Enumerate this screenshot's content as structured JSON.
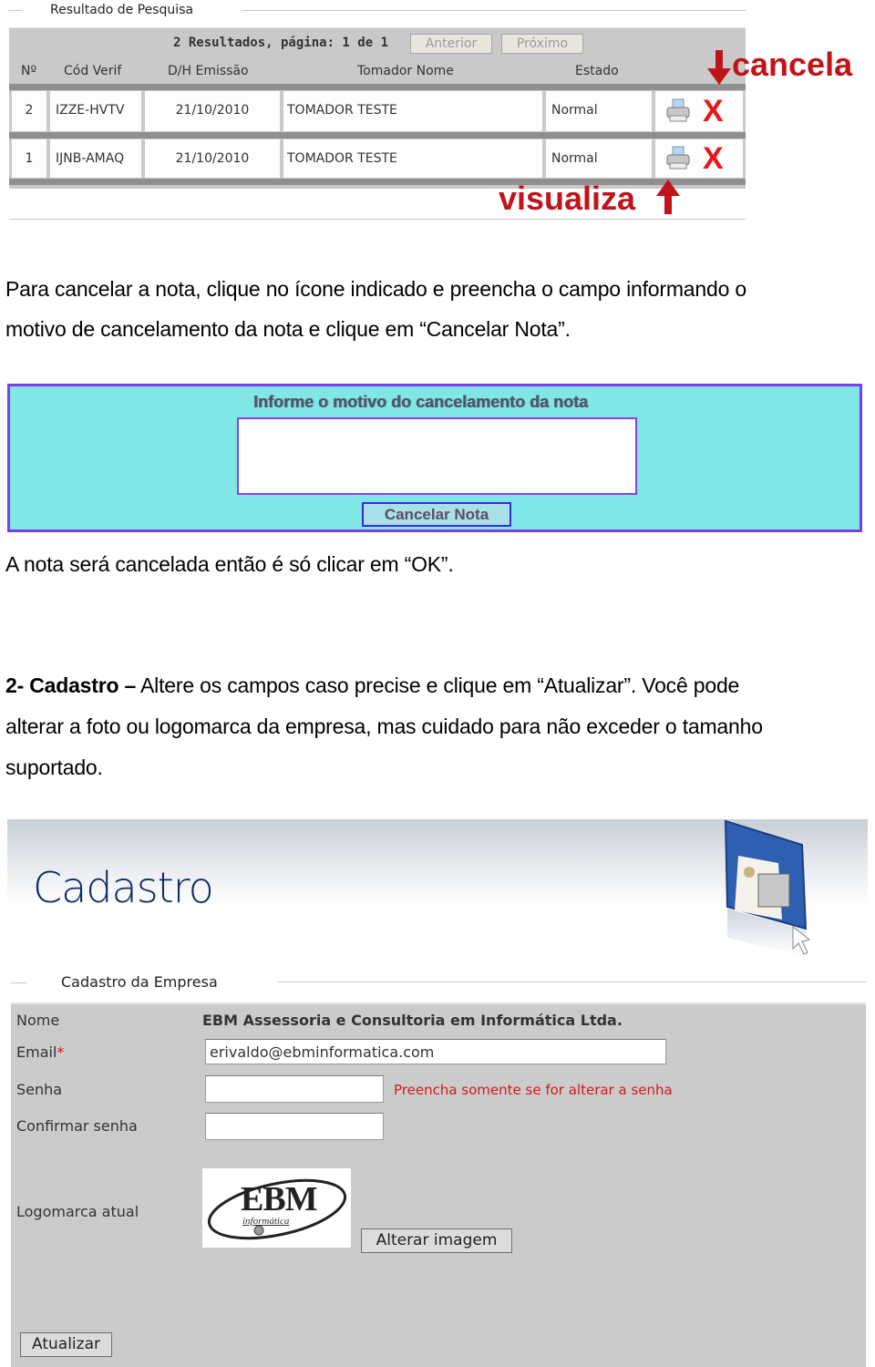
{
  "results": {
    "legend": "Resultado de Pesquisa",
    "summary": "2 Resultados, página: 1 de 1",
    "prev_label": "Anterior",
    "next_label": "Próximo",
    "columns": [
      "Nº",
      "Cód Verif",
      "D/H Emissão",
      "Tomador Nome",
      "Estado"
    ],
    "rows": [
      {
        "num": "2",
        "code": "IZZE-HVTV",
        "date": "21/10/2010",
        "tomador": "TOMADOR TESTE",
        "estado": "Normal"
      },
      {
        "num": "1",
        "code": "IJNB-AMAQ",
        "date": "21/10/2010",
        "tomador": "TOMADOR TESTE",
        "estado": "Normal"
      }
    ],
    "annotation_cancel": "cancela",
    "annotation_view": "visualiza",
    "cancel_glyph": "X",
    "accent_color": "#c0141b"
  },
  "text": {
    "p1_line1": "Para cancelar a nota, clique no ícone indicado e preencha o campo informando o",
    "p1_line2": "motivo de cancelamento da nota e clique em “Cancelar Nota”.",
    "p2": "A nota será cancelada então é só clicar em “OK”.",
    "p3_bold": "2- Cadastro –",
    "p3_line1": " Altere os campos caso precise e clique em “Atualizar”. Você pode",
    "p3_line2": "alterar a foto ou logomarca da empresa, mas cuidado para não exceder o tamanho",
    "p3_line3": "suportado."
  },
  "cancel_form": {
    "title": "Informe o motivo do cancelamento da nota",
    "textarea_value": "",
    "button_label": "Cancelar Nota"
  },
  "cadastro": {
    "header_title": "Cadastro",
    "legend": "Cadastro da Empresa",
    "nome_label": "Nome",
    "nome_value": "EBM Assessoria e Consultoria em Informática Ltda.",
    "email_label": "Email",
    "required_mark": "*",
    "email_value": "erivaldo@ebminformatica.com",
    "senha_label": "Senha",
    "senha_value": "",
    "senha_hint": "Preencha somente se for alterar a senha",
    "confirmar_label": "Confirmar senha",
    "confirmar_value": "",
    "logo_label": "Logomarca atual",
    "logo_text": "EBM",
    "logo_subtext": "informática",
    "alterar_label": "Alterar imagem",
    "atualizar_label": "Atualizar"
  }
}
